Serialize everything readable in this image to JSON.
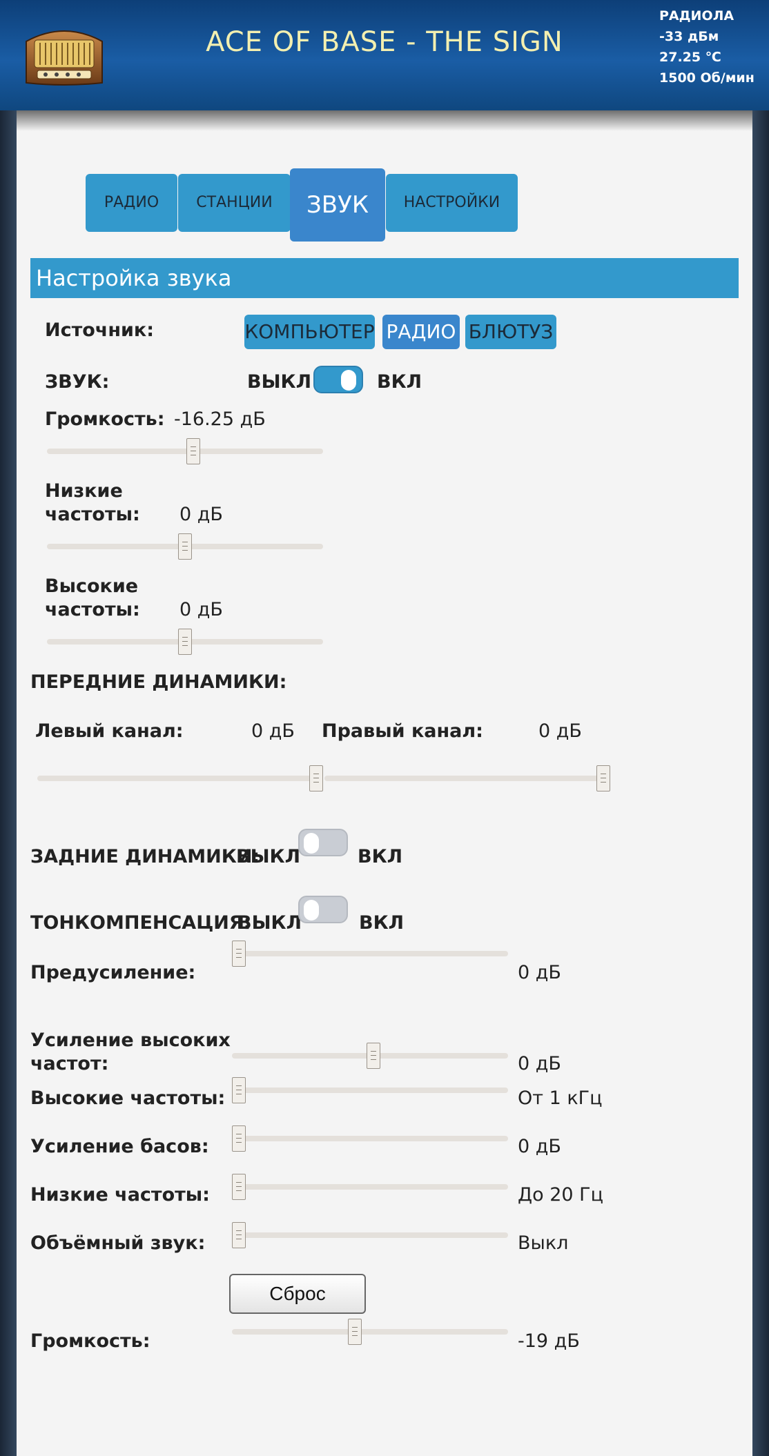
{
  "header": {
    "song_title": "ACE OF BASE - THE SIGN",
    "device_name": "РАДИОЛА",
    "signal": "-33 дБм",
    "temperature": "27.25 ℃",
    "rpm": "1500 Об/мин",
    "icon": "vintage-radio-icon"
  },
  "tabs": [
    {
      "label": "РАДИО",
      "active": false
    },
    {
      "label": "СТАНЦИИ",
      "active": false
    },
    {
      "label": "ЗВУК",
      "active": true
    },
    {
      "label": "НАСТРОЙКИ",
      "active": false
    }
  ],
  "section_title": "Настройка звука",
  "source": {
    "label": "Источник:",
    "options": [
      "КОМПЬЮТЕР",
      "РАДИО",
      "БЛЮТУЗ"
    ],
    "selected": "РАДИО"
  },
  "sound": {
    "label": "ЗВУК:",
    "off": "ВЫКЛ",
    "on": "ВКЛ",
    "state": true
  },
  "volume": {
    "label": "Громкость:",
    "value": "-16.25 дБ",
    "level": 0.53
  },
  "bass": {
    "label_line1": "Низкие",
    "label_line2": "частоты:",
    "value": "0 дБ",
    "level": 0.5
  },
  "treble": {
    "label_line1": "Высокие",
    "label_line2": "частоты:",
    "value": "0 дБ",
    "level": 0.5
  },
  "front": {
    "title": "ПЕРЕДНИЕ ДИНАМИКИ:",
    "left_label": "Левый канал:",
    "left_value": "0 дБ",
    "left_level": 1.0,
    "right_label": "Правый канал:",
    "right_value": "0 дБ",
    "right_level": 1.0
  },
  "rear": {
    "label": "ЗАДНИЕ ДИНАМИКИ:",
    "off": "ВЫКЛ",
    "on": "ВКЛ",
    "state": false
  },
  "loudness": {
    "label": "ТОНКОМПЕНСАЦИЯ:",
    "off": "ВЫКЛ",
    "on": "ВКЛ",
    "state": false
  },
  "sliders": [
    {
      "label": "Предусиление:",
      "value": "0 дБ",
      "level": 0.0
    },
    {
      "label": "Усиление высоких\nчастот:",
      "value": "0 дБ",
      "level": 0.5
    },
    {
      "label": "Высокие частоты:",
      "value": "От 1 кГц",
      "level": 0.0
    },
    {
      "label": "Усиление басов:",
      "value": "0 дБ",
      "level": 0.0
    },
    {
      "label": "Низкие частоты:",
      "value": "До 20 Гц",
      "level": 0.0
    },
    {
      "label": "Объёмный звук:",
      "value": "Выкл",
      "level": 0.0
    }
  ],
  "reset_label": "Сброс",
  "master_volume": {
    "label": "Громкость:",
    "value": "-19 дБ",
    "level": 0.43
  }
}
